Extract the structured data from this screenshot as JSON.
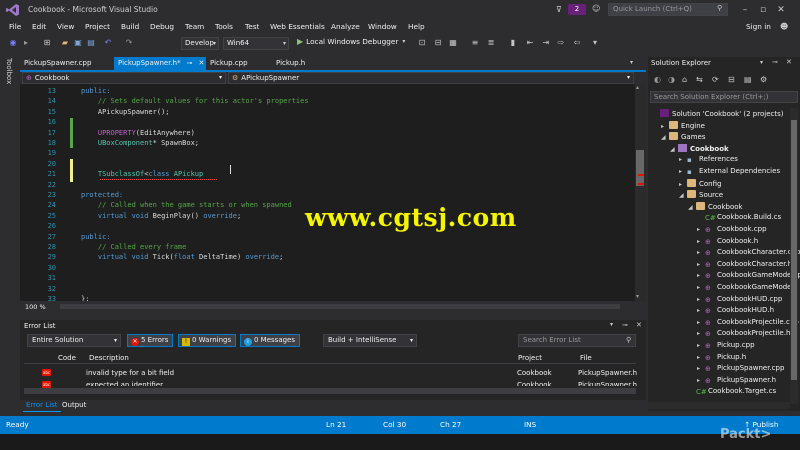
{
  "window": {
    "title": "Cookbook - Microsoft Visual Studio",
    "notification_count": "2",
    "quick_launch_placeholder": "Quick Launch (Ctrl+Q)",
    "sign_in": "Sign in"
  },
  "menu": [
    "File",
    "Edit",
    "View",
    "Project",
    "Build",
    "Debug",
    "Team",
    "Tools",
    "Test",
    "Web Essentials",
    "Analyze",
    "Window",
    "Help"
  ],
  "toolbar": {
    "configuration": "Develop",
    "platform": "Win64",
    "run_label": "Local Windows Debugger"
  },
  "side_strip": {
    "toolbox": "Toolbox"
  },
  "tabs": [
    {
      "label": "PickupSpawner.cpp",
      "active": false
    },
    {
      "label": "PickupSpawner.h*",
      "active": true
    },
    {
      "label": "Pickup.cpp",
      "active": false
    },
    {
      "label": "Pickup.h",
      "active": false
    }
  ],
  "navbar": {
    "project": "Cookbook",
    "scope": "APickupSpawner"
  },
  "editor": {
    "lines": [
      {
        "n": "13",
        "tokens": [
          {
            "t": "public:",
            "c": "kw"
          }
        ]
      },
      {
        "n": "14",
        "tokens": [
          {
            "t": "    // Sets default values for this actor's properties",
            "c": "cm"
          }
        ]
      },
      {
        "n": "15",
        "tokens": [
          {
            "t": "    APickupSpawner();",
            "c": ""
          }
        ]
      },
      {
        "n": "16",
        "tokens": []
      },
      {
        "n": "17",
        "tokens": [
          {
            "t": "    UPROPERTY",
            "c": "mac"
          },
          {
            "t": "(EditAnywhere)",
            "c": ""
          }
        ]
      },
      {
        "n": "18",
        "tokens": [
          {
            "t": "    UBoxComponent",
            "c": "ty"
          },
          {
            "t": "* SpawnBox;",
            "c": ""
          }
        ]
      },
      {
        "n": "19",
        "tokens": []
      },
      {
        "n": "20",
        "tokens": []
      },
      {
        "n": "21",
        "tokens": [
          {
            "t": "    TSubclassOf",
            "c": "ty"
          },
          {
            "t": "<",
            "c": ""
          },
          {
            "t": "class",
            "c": "kw"
          },
          {
            "t": " APickup",
            "c": "ty"
          }
        ]
      },
      {
        "n": "22",
        "tokens": []
      },
      {
        "n": "23",
        "tokens": [
          {
            "t": "protected:",
            "c": "kw"
          }
        ]
      },
      {
        "n": "24",
        "tokens": [
          {
            "t": "    // Called when the game starts or when spawned",
            "c": "cm"
          }
        ]
      },
      {
        "n": "25",
        "tokens": [
          {
            "t": "    virtual",
            "c": "kw"
          },
          {
            "t": " ",
            "c": ""
          },
          {
            "t": "void",
            "c": "kw"
          },
          {
            "t": " BeginPlay() ",
            "c": ""
          },
          {
            "t": "override",
            "c": "kw"
          },
          {
            "t": ";",
            "c": ""
          }
        ]
      },
      {
        "n": "26",
        "tokens": []
      },
      {
        "n": "27",
        "tokens": [
          {
            "t": "public:",
            "c": "kw"
          }
        ]
      },
      {
        "n": "28",
        "tokens": [
          {
            "t": "    // Called every frame",
            "c": "cm"
          }
        ]
      },
      {
        "n": "29",
        "tokens": [
          {
            "t": "    virtual",
            "c": "kw"
          },
          {
            "t": " ",
            "c": ""
          },
          {
            "t": "void",
            "c": "kw"
          },
          {
            "t": " Tick(",
            "c": ""
          },
          {
            "t": "float",
            "c": "kw"
          },
          {
            "t": " DeltaTime) ",
            "c": ""
          },
          {
            "t": "override",
            "c": "kw"
          },
          {
            "t": ";",
            "c": ""
          }
        ]
      },
      {
        "n": "30",
        "tokens": []
      },
      {
        "n": "31",
        "tokens": []
      },
      {
        "n": "32",
        "tokens": []
      },
      {
        "n": "33",
        "tokens": [
          {
            "t": "};",
            "c": ""
          }
        ]
      }
    ],
    "zoom": "100 %"
  },
  "watermark": "www.cgtsj.com",
  "error_list": {
    "title": "Error List",
    "scope": "Entire Solution",
    "errors": "5 Errors",
    "warnings": "0 Warnings",
    "messages": "0 Messages",
    "build_filter": "Build + IntelliSense",
    "search_placeholder": "Search Error List",
    "columns": [
      "Code",
      "Description",
      "Project",
      "File"
    ],
    "rows": [
      {
        "description": "invalid type for a bit field",
        "project": "Cookbook",
        "file": "PickupSpawner.h"
      },
      {
        "description": "expected an identifier",
        "project": "Cookbook",
        "file": "PickupSpawner.h"
      }
    ]
  },
  "bottom_tabs": [
    "Error List",
    "Output"
  ],
  "solution_explorer": {
    "title": "Solution Explorer",
    "search_placeholder": "Search Solution Explorer (Ctrl+;)",
    "items": [
      {
        "label": "Solution 'Cookbook' (2 projects)",
        "icon": "sln",
        "twisty": ""
      },
      {
        "label": "Engine",
        "icon": "folder",
        "twisty": "▸"
      },
      {
        "label": "Games",
        "icon": "folder",
        "twisty": "◢"
      },
      {
        "label": "Cookbook",
        "icon": "proj",
        "twisty": "◢"
      },
      {
        "label": "References",
        "icon": "ref",
        "twisty": "▸"
      },
      {
        "label": "External Dependencies",
        "icon": "ref",
        "twisty": "▸"
      },
      {
        "label": "Config",
        "icon": "folder",
        "twisty": "▸"
      },
      {
        "label": "Source",
        "icon": "folder",
        "twisty": "◢"
      },
      {
        "label": "Cookbook",
        "icon": "folder",
        "twisty": "◢"
      },
      {
        "label": "Cookbook.Build.cs",
        "icon": "cs",
        "twisty": ""
      },
      {
        "label": "Cookbook.cpp",
        "icon": "cpp",
        "twisty": "▸"
      },
      {
        "label": "Cookbook.h",
        "icon": "h",
        "twisty": "▸"
      },
      {
        "label": "CookbookCharacter.cpp",
        "icon": "cpp",
        "twisty": "▸"
      },
      {
        "label": "CookbookCharacter.h",
        "icon": "h",
        "twisty": "▸"
      },
      {
        "label": "CookbookGameMode.cpp",
        "icon": "cpp",
        "twisty": "▸"
      },
      {
        "label": "CookbookGameMode.h",
        "icon": "h",
        "twisty": "▸"
      },
      {
        "label": "CookbookHUD.cpp",
        "icon": "cpp",
        "twisty": "▸"
      },
      {
        "label": "CookbookHUD.h",
        "icon": "h",
        "twisty": "▸"
      },
      {
        "label": "CookbookProjectile.cpp",
        "icon": "cpp",
        "twisty": "▸"
      },
      {
        "label": "CookbookProjectile.h",
        "icon": "h",
        "twisty": "▸"
      },
      {
        "label": "Pickup.cpp",
        "icon": "cpp",
        "twisty": "▸"
      },
      {
        "label": "Pickup.h",
        "icon": "h",
        "twisty": "▸"
      },
      {
        "label": "PickupSpawner.cpp",
        "icon": "cpp",
        "twisty": "▸"
      },
      {
        "label": "PickupSpawner.h",
        "icon": "h",
        "twisty": "▸"
      },
      {
        "label": "Cookbook.Target.cs",
        "icon": "cs",
        "twisty": ""
      }
    ]
  },
  "statusbar": {
    "ready": "Ready",
    "line": "Ln 21",
    "col": "Col 30",
    "ch": "Ch 27",
    "mode": "INS",
    "publish": "Publish"
  },
  "brand": "Packt>",
  "colors": {
    "accent": "#007acc",
    "editor_bg": "#1e1e1e",
    "watermark": "#f5f500",
    "error": "#e51400"
  }
}
